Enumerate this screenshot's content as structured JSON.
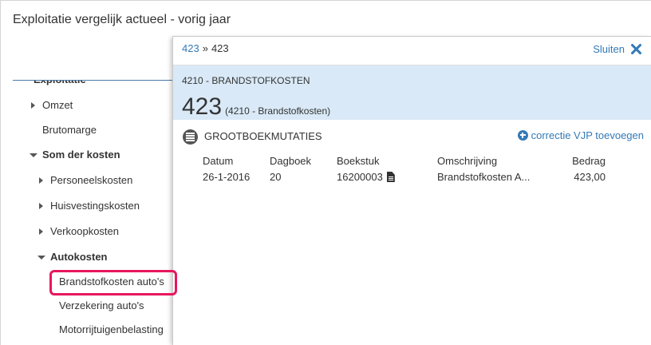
{
  "page": {
    "title": "Exploitatie vergelijk actueel - vorig jaar"
  },
  "tree": {
    "items": [
      {
        "label": "Exploitatie"
      },
      {
        "label": "Omzet",
        "toggle_icon": "caret-right-icon"
      },
      {
        "label": "Brutomarge"
      },
      {
        "label": "Som der kosten",
        "toggle_icon": "caret-down-icon"
      },
      {
        "label": "Personeelskosten",
        "toggle_icon": "caret-right-icon"
      },
      {
        "label": "Huisvestingskosten",
        "toggle_icon": "caret-right-icon"
      },
      {
        "label": "Verkoopkosten",
        "toggle_icon": "caret-right-icon"
      },
      {
        "label": "Autokosten",
        "toggle_icon": "caret-down-icon"
      },
      {
        "label": "Brandstofkosten auto's",
        "highlighted": true
      },
      {
        "label": "Verzekering auto's"
      },
      {
        "label": "Motorrijtuigenbelasting"
      }
    ]
  },
  "detail": {
    "breadcrumb": {
      "parent_link": "423",
      "separator": "»",
      "current": "423"
    },
    "close_label": "Sluiten",
    "close_icon": "close-icon",
    "account_heading": "4210 - BRANDSTOFKOSTEN",
    "amount": "423",
    "amount_note": "(4210 - Brandstofkosten)",
    "section": {
      "icon": "list-circle-icon",
      "title": "GROOTBOEKMUTATIES",
      "add_icon": "plus-circle-icon",
      "add_label": "correctie VJP toevoegen"
    },
    "table": {
      "columns": [
        "Datum",
        "Dagboek",
        "Boekstuk",
        "Omschrijving",
        "Bedrag"
      ],
      "rows": [
        {
          "datum": "26-1-2016",
          "dagboek": "20",
          "boekstuk": "16200003",
          "boekstuk_icon": "document-icon",
          "omschrijving": "Brandstofkosten A...",
          "bedrag": "423,00"
        }
      ]
    }
  },
  "colors": {
    "text": "#333333",
    "link": "#337ab7",
    "detail_band": "#d9e9f7",
    "highlight": "#e8175d",
    "icon_dark": "#555555"
  }
}
